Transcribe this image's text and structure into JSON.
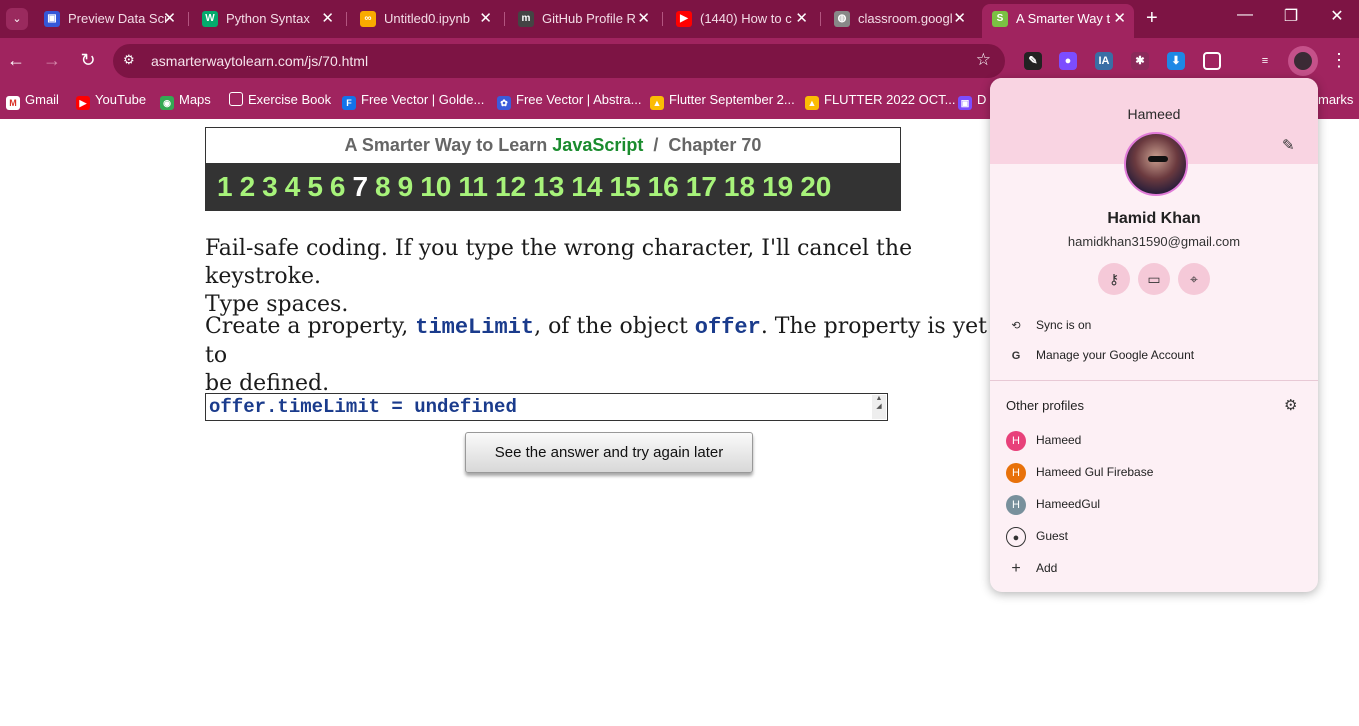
{
  "tabs": [
    {
      "label": "Preview Data Sci",
      "icon": "preview-icon",
      "color": "#3557d8"
    },
    {
      "label": "Python Syntax",
      "icon": "w3schools-icon",
      "color": "#04aa6d"
    },
    {
      "label": "Untitled0.ipynb",
      "icon": "colab-icon",
      "color": "#f9ab00"
    },
    {
      "label": "GitHub Profile R",
      "icon": "github-icon",
      "color": "#444444"
    },
    {
      "label": "(1440) How to c",
      "icon": "youtube-icon",
      "color": "#ff0000"
    },
    {
      "label": "classroom.googl",
      "icon": "globe-icon",
      "color": "#888888"
    },
    {
      "label": "A Smarter Way t",
      "icon": "smarter-way-icon",
      "color": "#7bc143"
    }
  ],
  "toolbar": {
    "url": "asmarterwaytolearn.com/js/70.html"
  },
  "bookmarks": [
    {
      "label": "Gmail"
    },
    {
      "label": "YouTube"
    },
    {
      "label": "Maps"
    },
    {
      "label": "Exercise Book"
    },
    {
      "label": "Free Vector | Golde..."
    },
    {
      "label": "Free Vector | Abstra..."
    },
    {
      "label": "Flutter September 2..."
    },
    {
      "label": "FLUTTER 2022 OCT..."
    },
    {
      "label": "D"
    },
    {
      "label": "marks"
    }
  ],
  "lesson": {
    "title_prefix": "A Smarter Way to Learn",
    "title_js": "JavaScript",
    "title_sep": "/",
    "title_chapter": "Chapter 70",
    "chapters": [
      "1",
      "2",
      "3",
      "4",
      "5",
      "6",
      "7",
      "8",
      "9",
      "10",
      "11",
      "12",
      "13",
      "14",
      "15",
      "16",
      "17",
      "18",
      "19",
      "20"
    ],
    "current_chapter": "7"
  },
  "instructions": {
    "line1": "Fail-safe coding. If you type the wrong character, I'll cancel the keystroke.",
    "line2": "Type spaces.",
    "p2_a": "Create a property, ",
    "p2_code1": "timeLimit",
    "p2_b": ", of the object ",
    "p2_code2": "offer",
    "p2_c": ". The property is yet to",
    "p2_line2": "be defined."
  },
  "answer": {
    "value": "offer.timeLimit = undefined",
    "button_label": "See the answer and try again later"
  },
  "profile": {
    "header_name": "Hameed",
    "full_name": "Hamid Khan",
    "email": "hamidkhan31590@gmail.com",
    "sync_label": "Sync is on",
    "manage_label": "Manage your Google Account",
    "other_title": "Other profiles",
    "others": [
      {
        "name": "Hameed",
        "initial": "H",
        "color": "#e8417a"
      },
      {
        "name": "Hameed Gul Firebase",
        "initial": "H",
        "color": "#e8710a"
      },
      {
        "name": "HameedGul",
        "initial": "H",
        "color": "#78909c"
      }
    ],
    "guest_label": "Guest",
    "add_label": "Add"
  }
}
